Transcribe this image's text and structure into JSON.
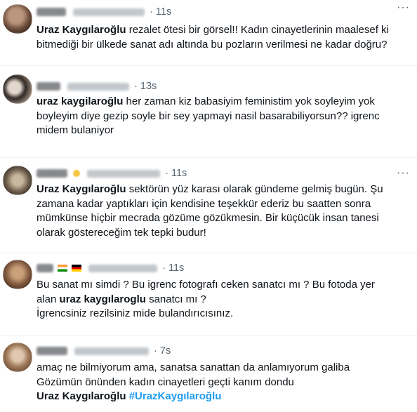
{
  "tweets": [
    {
      "time": "· 11s",
      "mention": "Uraz Kaygılaroğlu",
      "text_after": " rezalet ötesi bir görsel!! Kadın cinayetlerinin maalesef ki",
      "line2": "bitmediği bir ülkede sanat adı altında bu pozların verilmesi ne kadar doğru?",
      "more": "···"
    },
    {
      "time": "· 13s",
      "mention": "uraz kaygilaroğlu",
      "text_after": " her zaman kiz babasiyim feministim yok soyleyim yok",
      "line2": "boyleyim diye gezip soyle bir sey yapmayi nasil basarabiliyorsun?? igrenc",
      "line3": "midem bulaniyor"
    },
    {
      "time": "· 11s",
      "mention": "Uraz Kaygılaroğlu",
      "text_after": " sektörün yüz karası olarak gündeme gelmiş bugün. Şu",
      "line2": "zamana kadar yaptıkları için kendisine teşekkür ederiz bu saatten sonra",
      "line3": "mümkünse hiçbir mecrada gözüme gözükmesin. Bir küçücük insan tanesi",
      "line4": "olarak göstereceğim tek tepki budur!"
    },
    {
      "time": "· 11s",
      "line1": "Bu sanat mı simdi ? Bu igrenc fotografı ceken sanatcı mı ? Bu fotoda yer",
      "before": "alan ",
      "mention": "uraz kaygılaroglu",
      "after": " sanatcı mı ?",
      "line3": "İgrencsiniz rezilsiniz mide bulandırıcısınız."
    },
    {
      "time": "· 7s",
      "line1": "amaç ne bilmiyorum ama, sanatsa sanattan da anlamıyorum galiba",
      "line2": "Gözümün önünden kadın cinayetleri geçti kanım dondu",
      "mention": "Uraz Kaygılaroğlu",
      "hashtag": "#UrazKaygılaroğlu"
    }
  ],
  "colors": {
    "text": "#0f1419",
    "muted": "#536471",
    "link": "#1d9bf0",
    "divider": "#eff3f4"
  }
}
